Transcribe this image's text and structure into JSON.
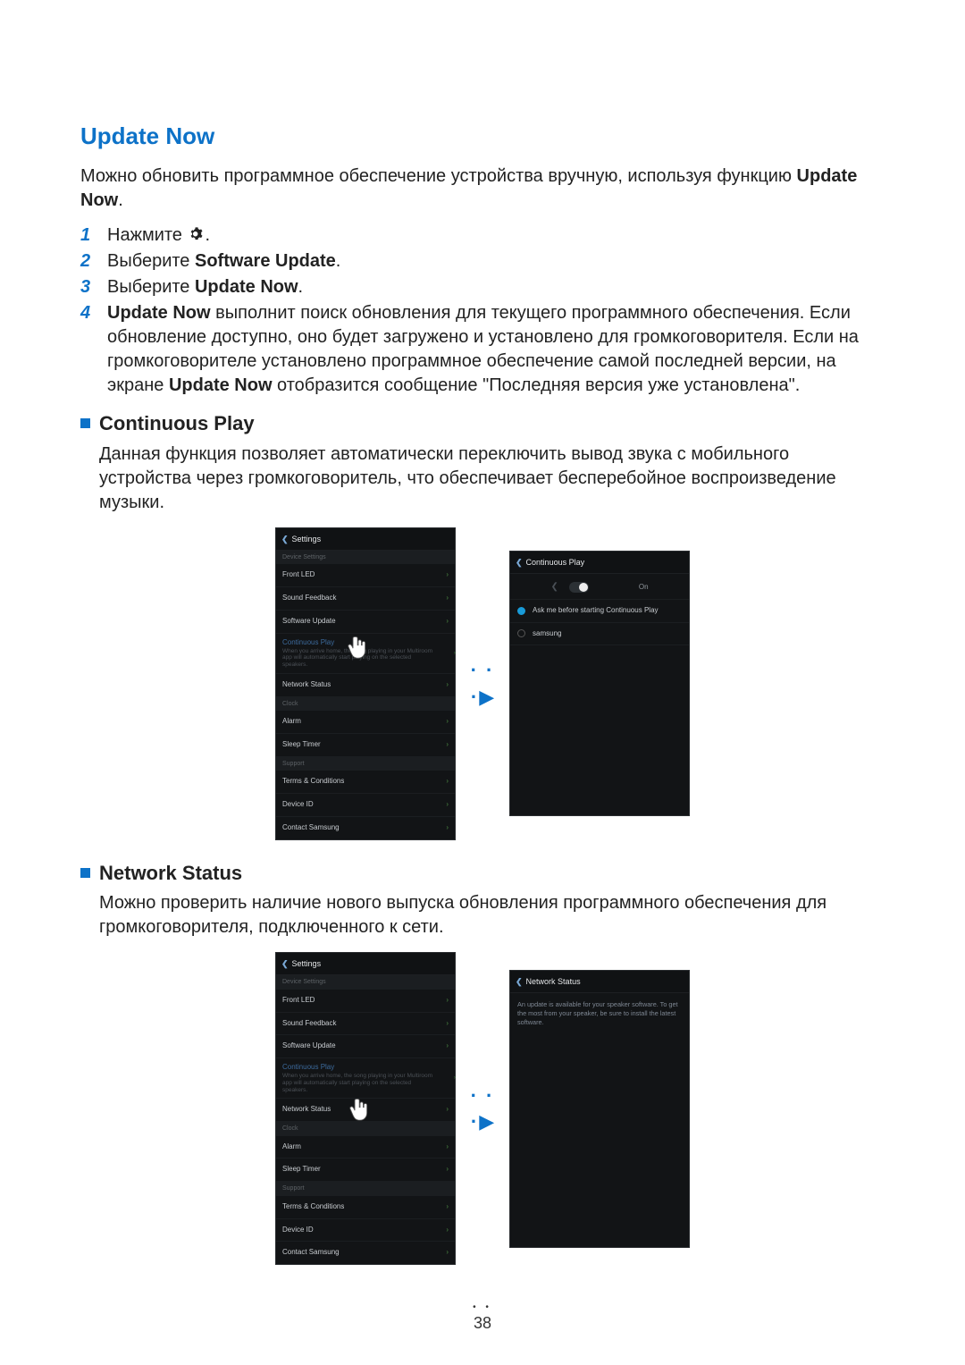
{
  "page_number": "38",
  "headings": {
    "update_now": "Update Now",
    "continuous_play": "Continuous Play",
    "network_status": "Network Status"
  },
  "intro": {
    "prefix": "Можно обновить программное обеспечение устройства вручную, используя функцию ",
    "bold": "Update Now",
    "suffix": "."
  },
  "steps": {
    "s1_num": "1",
    "s1_text": "Нажмите ",
    "s1_suffix": ".",
    "s2_num": "2",
    "s2_prefix": "Выберите ",
    "s2_bold": "Software Update",
    "s2_suffix": ".",
    "s3_num": "3",
    "s3_prefix": "Выберите ",
    "s3_bold": "Update Now",
    "s3_suffix": ".",
    "s4_num": "4",
    "s4_b1": "Update Now",
    "s4_mid1": " выполнит поиск обновления для текущего программного обеспечения. Если обновление доступно, оно будет загружено и установлено для громкоговорителя. Если на громкоговорителе установлено программное обеспечение самой последней версии, на экране ",
    "s4_b2": "Update Now",
    "s4_mid2": " отобразится сообщение \"Последняя версия уже установлена\"."
  },
  "continuous_body": "Данная функция позволяет автоматически переключить вывод звука с мобильного устройства через громкоговоритель, что обеспечивает бесперебойное воспроизведение музыки.",
  "network_body": "Можно проверить наличие нового выпуска обновления программного обеспечения для громкоговорителя, подключенного к сети.",
  "settings_screen": {
    "title": "Settings",
    "section_device": "Device Settings",
    "front_led": "Front LED",
    "sound_feedback": "Sound Feedback",
    "software_update": "Software Update",
    "continuous_play": "Continuous Play",
    "continuous_desc": "When you arrive home, the song playing in your Multiroom app will automatically start playing on the selected speakers.",
    "network_status": "Network Status",
    "section_clock": "Clock",
    "alarm": "Alarm",
    "sleep_timer": "Sleep Timer",
    "section_support": "Support",
    "terms": "Terms & Conditions",
    "device_id": "Device ID",
    "contact": "Contact Samsung"
  },
  "continuous_screen": {
    "title": "Continuous Play",
    "toggle_label": "On",
    "opt1": "Ask me before starting Continuous Play",
    "opt2": "samsung"
  },
  "network_screen": {
    "title": "Network Status",
    "message": "An update is available for your speaker software. To get the most from your speaker, be sure to install the latest software."
  },
  "arrow_glyph_dots": "· · ·",
  "arrow_glyph_tri": "▶"
}
